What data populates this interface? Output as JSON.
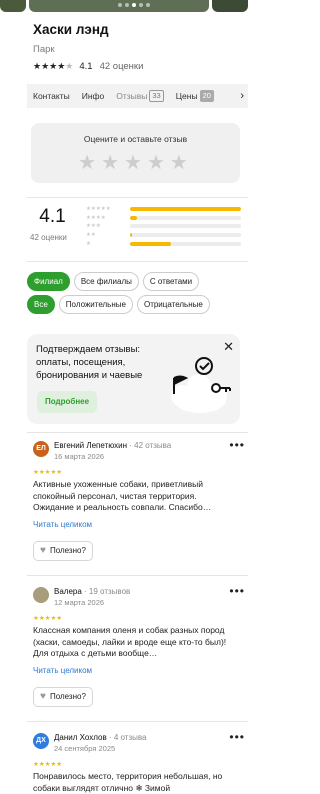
{
  "place": {
    "title": "Хаски лэнд",
    "category": "Парк",
    "rating": "4.1",
    "rating_stars": 4,
    "reviews_count": "42 оценки"
  },
  "gallery": {
    "slides": 5,
    "active_slide": 3
  },
  "tabs": [
    {
      "label": "Контакты",
      "badge": ""
    },
    {
      "label": "Инфо",
      "badge": ""
    },
    {
      "label": "Отзывы",
      "badge": "33"
    },
    {
      "label": "Цены",
      "badge": "20"
    }
  ],
  "rate_box": {
    "title": "Оцените и оставьте отзыв"
  },
  "summary": {
    "rating": "4.1",
    "count_label": "42 оценки",
    "distribution": [
      {
        "stars": 5,
        "fraction": 1.0
      },
      {
        "stars": 4,
        "fraction": 0.06
      },
      {
        "stars": 3,
        "fraction": 0.0
      },
      {
        "stars": 2,
        "fraction": 0.02
      },
      {
        "stars": 1,
        "fraction": 0.37
      }
    ]
  },
  "filters": [
    "Филиал",
    "Все филиалы",
    "С ответами"
  ],
  "sort": [
    "Все",
    "Положительные",
    "Отрицательные"
  ],
  "promo": {
    "text": "Подтверждаем отзывы: оплаты, посещения, бронирования и чаевые",
    "button": "Подробнее"
  },
  "reviews": [
    {
      "initials": "ЕЛ",
      "avatar_color": "#c8621b",
      "name": "Евгений Лепетюхин",
      "count": "· 42 отзыва",
      "date": "16 марта 2026",
      "stars": 5,
      "text": "Активные ухоженные собаки, приветливый спокойный персонал, чистая территория. Ожидание и реальность совпали. Спасибо…",
      "read_more": "Читать целиком",
      "helpful": "Полезно?"
    },
    {
      "initials": "",
      "avatar_color": "#a79d7a",
      "name": "Валера",
      "count": "· 19 отзывов",
      "date": "12 марта 2026",
      "stars": 5,
      "text": "Классная компания оленя и собак разных пород (хаски, самоеды, лайки и вроде еще кто-то был)! Для отдыха с детьми вообще…",
      "read_more": "Читать целиком",
      "helpful": "Полезно?"
    },
    {
      "initials": "ДХ",
      "avatar_color": "#2f7de1",
      "name": "Данил Хохлов",
      "count": "· 4 отзыва",
      "date": "24 сентября 2025",
      "stars": 5,
      "text": "Понравилось место, территория небольшая, но собаки выглядят отлично ❄ Зимой",
      "read_more": "",
      "helpful": ""
    }
  ],
  "colors": {
    "accent": "#2e9f2f",
    "star": "#f6b900",
    "link": "#2e7ad1"
  }
}
